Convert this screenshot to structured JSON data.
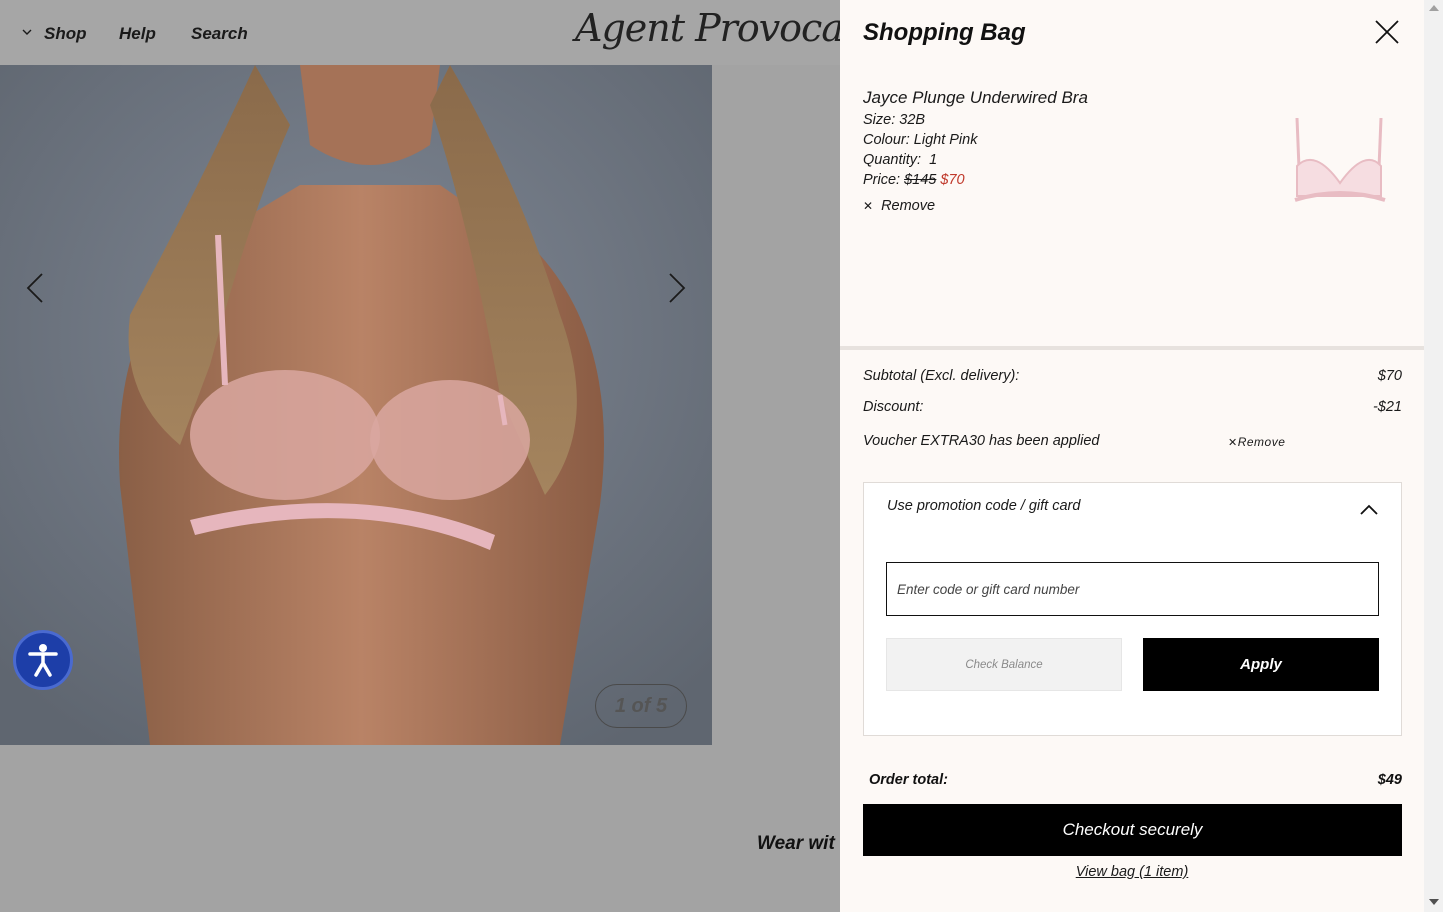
{
  "nav": {
    "shop": "Shop",
    "help": "Help",
    "search": "Search",
    "logo": "Agent Provocateur"
  },
  "gallery": {
    "counter": "1 of 5"
  },
  "promo_text": "Wear wit",
  "bag": {
    "title": "Shopping Bag",
    "item": {
      "name": "Jayce Plunge Underwired Bra",
      "size_label": "Size:",
      "size": "32B",
      "colour_label": "Colour:",
      "colour": "Light Pink",
      "quantity_label": "Quantity:",
      "quantity": "1",
      "price_label": "Price:",
      "price_original": "$145",
      "price_sale": "$70",
      "remove": "Remove"
    },
    "summary": {
      "subtotal_label": "Subtotal (Excl. delivery):",
      "subtotal": "$70",
      "discount_label": "Discount:",
      "discount": "-$21",
      "voucher_text": "Voucher EXTRA30 has been applied",
      "voucher_remove": "Remove"
    },
    "promo": {
      "heading": "Use promotion code / gift card",
      "placeholder": "Enter code or gift card number",
      "check_balance": "Check Balance",
      "apply": "Apply"
    },
    "order_total_label": "Order total:",
    "order_total": "$49",
    "checkout": "Checkout securely",
    "view_bag": "View bag (1 item)"
  },
  "colors": {
    "sale": "#c0392b",
    "overlay": "#a3a3a3",
    "drawer_bg": "#fdf9f6",
    "accessibility": "#1d3ea8"
  }
}
